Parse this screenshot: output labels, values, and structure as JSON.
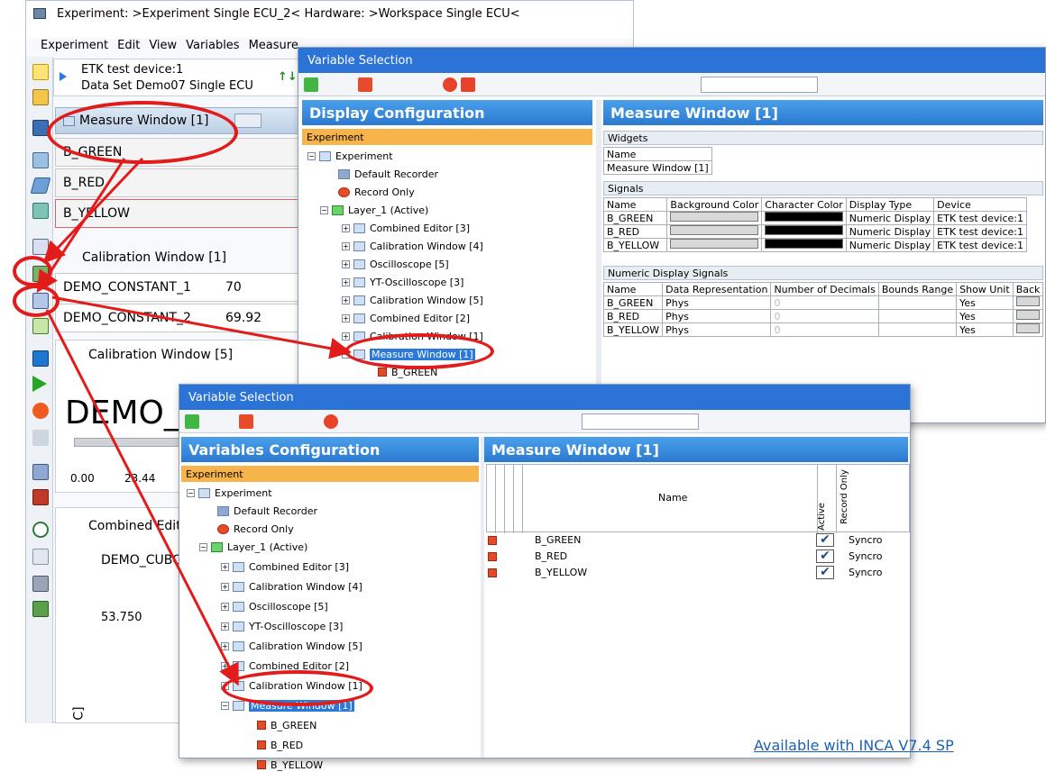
{
  "main_window": {
    "title": "Experiment: >Experiment Single ECU_2< Hardware: >Workspace Single ECU<",
    "menu": [
      "Experiment",
      "Edit",
      "View",
      "Variables",
      "Measure"
    ],
    "device_line1": "ETK test device:1",
    "device_line2": "Data Set Demo07 Single ECU",
    "measure_window_title": "Measure Window [1]",
    "measure_rows": [
      "B_GREEN",
      "B_RED",
      "B_YELLOW"
    ],
    "calib_title": "Calibration Window [1]",
    "calib_rows": [
      {
        "name": "DEMO_CONSTANT_1",
        "value": "70"
      },
      {
        "name": "DEMO_CONSTANT_2",
        "value": "69.92"
      }
    ],
    "calib5_title": "Calibration Window [5]",
    "calib5_big": "DEMO_",
    "calib5_ticks": [
      "0.00",
      "23.44"
    ],
    "combined_title": "Combined Editor",
    "combined_var": "DEMO_CUBOI",
    "combined_value": "53.750",
    "combined_axis": "C]"
  },
  "vs1": {
    "title": "Variable Selection",
    "left_header": "Display Configuration",
    "right_header": "Measure Window [1]",
    "experiment_label": "Experiment",
    "widgets_section": "Widgets",
    "widgets_name_header": "Name",
    "widgets_name_value": "Measure Window [1]",
    "signals_section": "Signals",
    "signals_headers": [
      "Name",
      "Background Color",
      "Character Color",
      "Display Type",
      "Device"
    ],
    "signals": [
      {
        "name": "B_GREEN",
        "display": "Numeric Display",
        "device": "ETK test device:1"
      },
      {
        "name": "B_RED",
        "display": "Numeric Display",
        "device": "ETK test device:1"
      },
      {
        "name": "B_YELLOW",
        "display": "Numeric Display",
        "device": "ETK test device:1"
      }
    ],
    "numeric_section": "Numeric Display Signals",
    "numeric_headers": [
      "Name",
      "Data Representation",
      "Number of Decimals",
      "Bounds Range",
      "Show Unit",
      "Back"
    ],
    "numeric": [
      {
        "name": "B_GREEN",
        "rep": "Phys",
        "dec": "0",
        "unit": "Yes"
      },
      {
        "name": "B_RED",
        "rep": "Phys",
        "dec": "0",
        "unit": "Yes"
      },
      {
        "name": "B_YELLOW",
        "rep": "Phys",
        "dec": "0",
        "unit": "Yes"
      }
    ]
  },
  "tree": {
    "experiment": "Experiment",
    "default_recorder": "Default Recorder",
    "record_only": "Record Only",
    "layer": "Layer_1 (Active)",
    "items": [
      "Combined Editor [3]",
      "Calibration Window [4]",
      "Oscilloscope [5]",
      "YT-Oscilloscope [3]",
      "Calibration Window [5]",
      "Combined Editor [2]",
      "Calibration Window [1]",
      "Measure Window [1]"
    ],
    "signals": [
      "B_GREEN",
      "B_RED",
      "B_YELLOW"
    ]
  },
  "vs2": {
    "title": "Variable Selection",
    "left_header": "Variables Configuration",
    "right_header": "Measure Window [1]",
    "experiment_label": "Experiment",
    "col_name": "Name",
    "col_active": "Active",
    "col_record": "Record Only",
    "rows": [
      {
        "name": "B_GREEN",
        "mode": "Syncro"
      },
      {
        "name": "B_RED",
        "mode": "Syncro"
      },
      {
        "name": "B_YELLOW",
        "mode": "Syncro"
      }
    ]
  },
  "footer": "Available with INCA V7.4 SP",
  "colors": {
    "accent": "#2b79d8",
    "highlight": "#e21b1b",
    "orange": "#f7b44a"
  }
}
